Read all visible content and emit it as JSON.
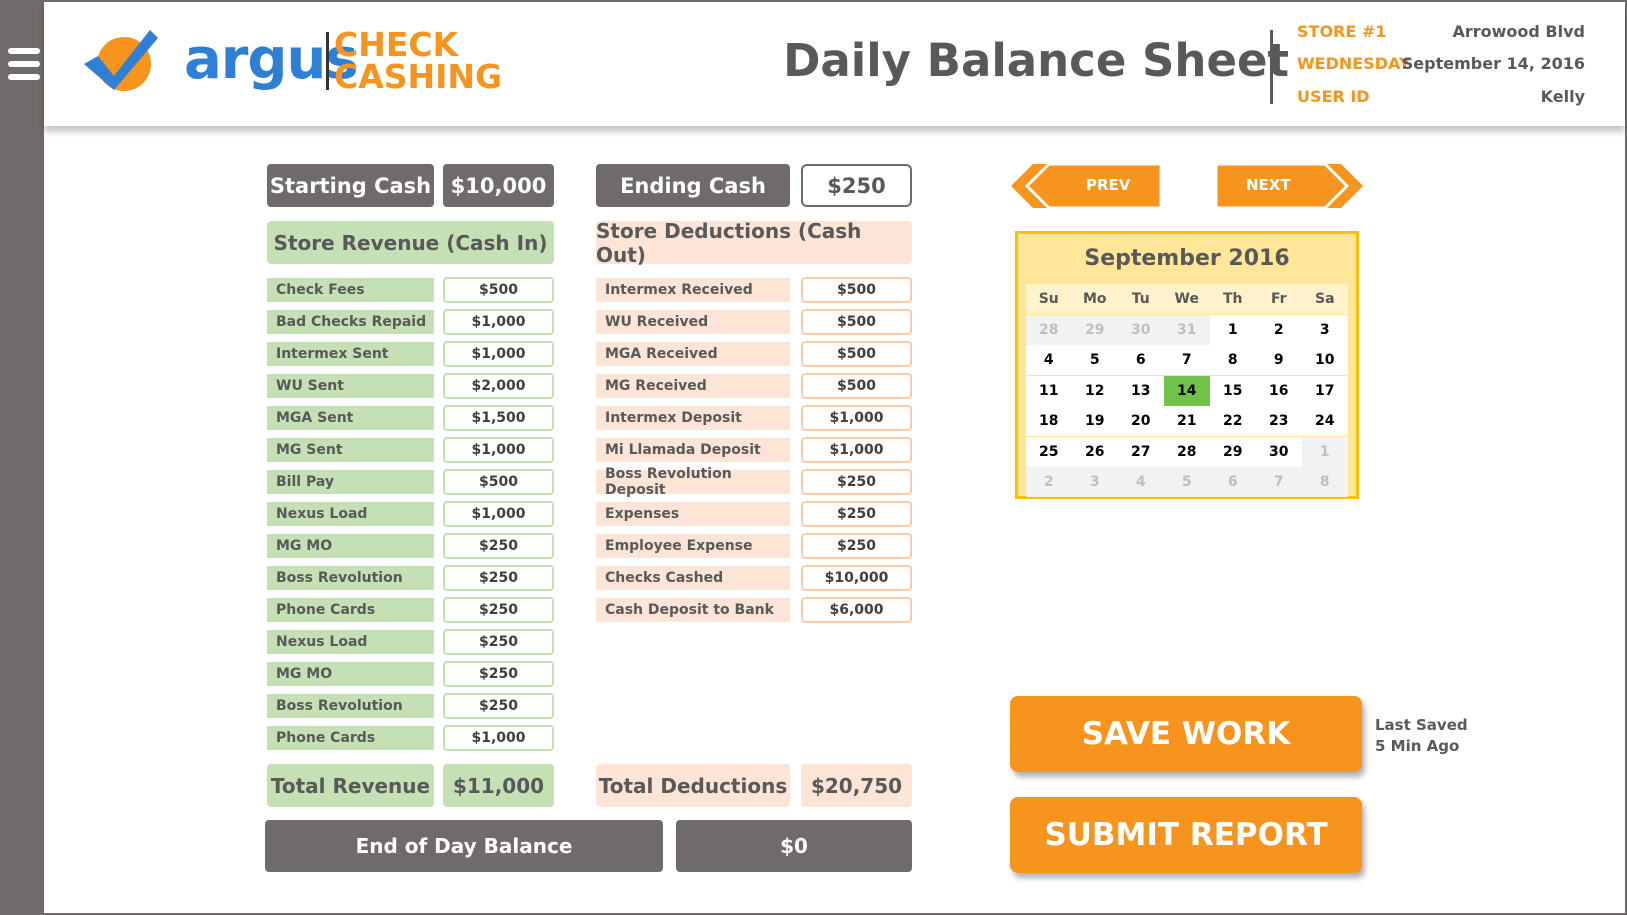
{
  "menu": {
    "icon": "hamburger-menu-icon"
  },
  "logo": {
    "word": "argus",
    "line1": "CHECK",
    "line2": "CASHING",
    "brand_blue": "#2f7fd4",
    "brand_orange": "#f7941d"
  },
  "header": {
    "title": "Daily Balance Sheet",
    "store_label": "STORE #1",
    "store_value": "Arrowood Blvd",
    "day_label": "WEDNESDAY",
    "date_value": "September 14, 2016",
    "user_label": "USER ID",
    "user_value": "Kelly"
  },
  "summary": {
    "starting_label": "Starting Cash",
    "starting_value": "$10,000",
    "ending_label": "Ending Cash",
    "ending_value": "$250"
  },
  "revenue": {
    "heading": "Store Revenue (Cash In)",
    "rows": [
      {
        "label": "Check Fees",
        "value": "$500"
      },
      {
        "label": "Bad Checks Repaid",
        "value": "$1,000"
      },
      {
        "label": "Intermex Sent",
        "value": "$1,000"
      },
      {
        "label": "WU Sent",
        "value": "$2,000"
      },
      {
        "label": "MGA Sent",
        "value": "$1,500"
      },
      {
        "label": "MG Sent",
        "value": "$1,000"
      },
      {
        "label": "Bill Pay",
        "value": "$500"
      },
      {
        "label": "Nexus Load",
        "value": "$1,000"
      },
      {
        "label": "MG MO",
        "value": "$250"
      },
      {
        "label": "Boss Revolution",
        "value": "$250"
      },
      {
        "label": "Phone Cards",
        "value": "$250"
      },
      {
        "label": "Nexus Load",
        "value": "$250"
      },
      {
        "label": "MG MO",
        "value": "$250"
      },
      {
        "label": "Boss Revolution",
        "value": "$250"
      },
      {
        "label": "Phone Cards",
        "value": "$1,000"
      }
    ],
    "total_label": "Total Revenue",
    "total_value": "$11,000"
  },
  "deductions": {
    "heading": "Store Deductions (Cash Out)",
    "rows": [
      {
        "label": "Intermex Received",
        "value": "$500"
      },
      {
        "label": "WU Received",
        "value": "$500"
      },
      {
        "label": "MGA Received",
        "value": "$500"
      },
      {
        "label": "MG Received",
        "value": "$500"
      },
      {
        "label": "Intermex Deposit",
        "value": "$1,000"
      },
      {
        "label": "Mi Llamada Deposit",
        "value": "$1,000"
      },
      {
        "label": "Boss Revolution Deposit",
        "value": "$250"
      },
      {
        "label": "Expenses",
        "value": "$250"
      },
      {
        "label": "Employee Expense",
        "value": "$250"
      },
      {
        "label": "Checks Cashed",
        "value": "$10,000"
      },
      {
        "label": "Cash Deposit to Bank",
        "value": "$6,000"
      }
    ],
    "total_label": "Total Deductions",
    "total_value": "$20,750"
  },
  "balance": {
    "label": "End of Day Balance",
    "value": "$0"
  },
  "nav": {
    "prev": "PREV",
    "next": "NEXT"
  },
  "calendar": {
    "title": "September 2016",
    "weekdays": [
      "Su",
      "Mo",
      "Tu",
      "We",
      "Th",
      "Fr",
      "Sa"
    ],
    "weeks": [
      [
        {
          "d": "28",
          "o": true
        },
        {
          "d": "29",
          "o": true
        },
        {
          "d": "30",
          "o": true
        },
        {
          "d": "31",
          "o": true
        },
        {
          "d": "1"
        },
        {
          "d": "2"
        },
        {
          "d": "3"
        }
      ],
      [
        {
          "d": "4"
        },
        {
          "d": "5"
        },
        {
          "d": "6"
        },
        {
          "d": "7"
        },
        {
          "d": "8"
        },
        {
          "d": "9"
        },
        {
          "d": "10"
        }
      ],
      [
        {
          "d": "11"
        },
        {
          "d": "12"
        },
        {
          "d": "13"
        },
        {
          "d": "14",
          "s": true
        },
        {
          "d": "15"
        },
        {
          "d": "16"
        },
        {
          "d": "17"
        }
      ],
      [
        {
          "d": "18"
        },
        {
          "d": "19"
        },
        {
          "d": "20"
        },
        {
          "d": "21"
        },
        {
          "d": "22"
        },
        {
          "d": "23"
        },
        {
          "d": "24"
        }
      ],
      [
        {
          "d": "25"
        },
        {
          "d": "26"
        },
        {
          "d": "27"
        },
        {
          "d": "28"
        },
        {
          "d": "29"
        },
        {
          "d": "30"
        },
        {
          "d": "1",
          "o": true
        }
      ],
      [
        {
          "d": "2",
          "o": true
        },
        {
          "d": "3",
          "o": true
        },
        {
          "d": "4",
          "o": true
        },
        {
          "d": "5",
          "o": true
        },
        {
          "d": "6",
          "o": true
        },
        {
          "d": "7",
          "o": true
        },
        {
          "d": "8",
          "o": true
        }
      ]
    ]
  },
  "actions": {
    "save_label": "SAVE WORK",
    "submit_label": "SUBMIT REPORT",
    "last_saved_line1": "Last Saved",
    "last_saved_line2": "5 Min Ago"
  },
  "colors": {
    "accent": "#f7941d",
    "dark_gray": "#6f6b6a",
    "revenue_green": "#c5e0b4",
    "deduction_peach": "#fce4d6",
    "calendar_yellow": "#ffe699",
    "selected_day": "#70c24a"
  }
}
